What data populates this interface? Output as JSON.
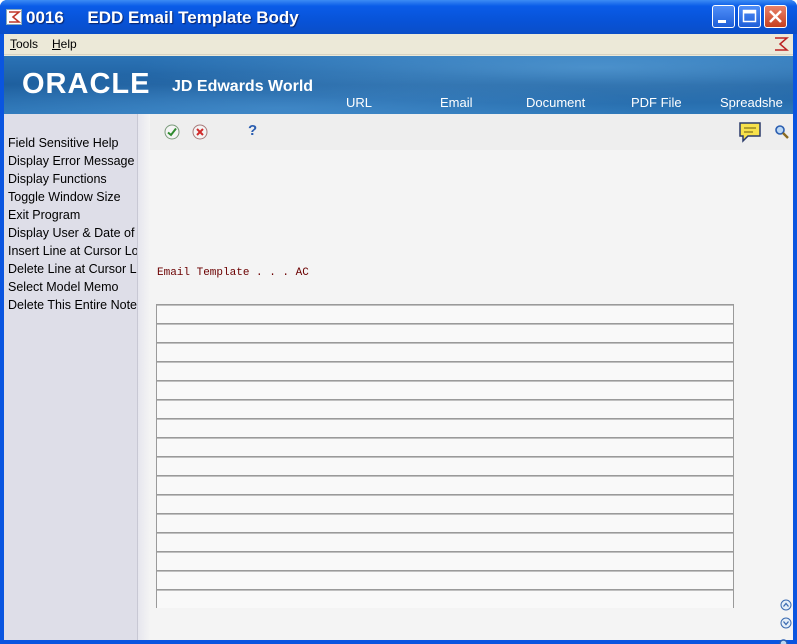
{
  "window": {
    "title": "0016     EDD Email Template Body",
    "buttons": [
      "minimize",
      "maximize",
      "close"
    ]
  },
  "menubar": {
    "items": [
      {
        "accel": "T",
        "rest": "ools"
      },
      {
        "accel": "H",
        "rest": "elp"
      }
    ],
    "right_icon": "jde-exit-icon"
  },
  "banner": {
    "oracle": "ORACLE",
    "product": "JD Edwards World",
    "links": [
      "URL",
      "Email",
      "Document",
      "PDF File",
      "Spreadshe"
    ]
  },
  "sidebar": {
    "items": [
      "Field Sensitive Help",
      "Display Error Message",
      "Display Functions",
      "Toggle Window Size",
      "Exit Program",
      "Display User & Date of l",
      "Insert Line at Cursor Loc",
      "Delete Line at Cursor Lo",
      "Select Model Memo",
      "Delete This Entire Note"
    ]
  },
  "toolbar": {
    "icons": [
      "ok-check-icon",
      "cancel-x-icon",
      "help-question-icon",
      "memo-note-icon",
      "search-magnifier-icon"
    ],
    "help_glyph": "?"
  },
  "form": {
    "email_template_label": "Email Template . . . AC"
  },
  "grid": {
    "row_count": 16
  },
  "colors": {
    "field_label": "#6b0000",
    "banner": "#1e5f9e",
    "title_bar": "#0a5ce8"
  }
}
